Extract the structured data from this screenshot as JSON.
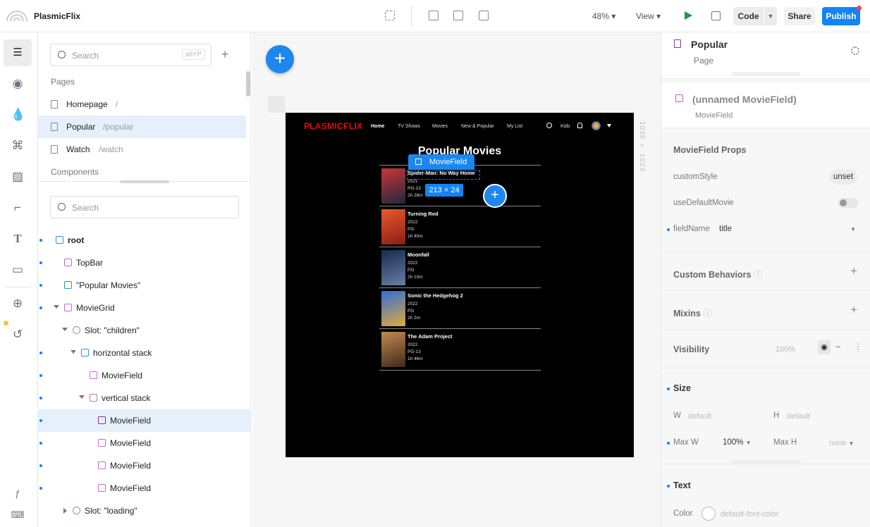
{
  "app": {
    "name": "PlasmicFlix"
  },
  "toolbar": {
    "zoom": "48%",
    "view": "View",
    "code": "Code",
    "share": "Share",
    "publish": "Publish"
  },
  "nav": {
    "search_placeholder": "Search",
    "search_shortcut": "alt+P",
    "pages_label": "Pages",
    "pages": [
      {
        "name": "Homepage",
        "path": "/"
      },
      {
        "name": "Popular",
        "path": "/popular"
      },
      {
        "name": "Watch",
        "path": "/watch"
      }
    ],
    "components_label": "Components",
    "tree_search_placeholder": "Search",
    "tree": [
      {
        "label": "root"
      },
      {
        "label": "TopBar"
      },
      {
        "label": "\"Popular Movies\""
      },
      {
        "label": "MovieGrid"
      },
      {
        "label": "Slot: \"children\""
      },
      {
        "label": "horizontal stack"
      },
      {
        "label": "MovieField"
      },
      {
        "label": "vertical stack"
      },
      {
        "label": "MovieField"
      },
      {
        "label": "MovieField"
      },
      {
        "label": "MovieField"
      },
      {
        "label": "MovieField"
      },
      {
        "label": "Slot: \"loading\""
      }
    ]
  },
  "canvas": {
    "frame_size": "1035 × 1024",
    "selection_tag": "MovieField",
    "selection_size": "213 × 24",
    "site": {
      "logo": "PLASMICFLIX",
      "links": [
        "Home",
        "TV Shows",
        "Movies",
        "New & Popular",
        "My List"
      ],
      "kids": "Kids",
      "title": "Popular Movies",
      "movies": [
        {
          "title": "Spider-Man: No Way Home",
          "year": "2021",
          "rating": "PG-13",
          "runtime": "2h 28m",
          "color": "#7a2a2a"
        },
        {
          "title": "Turning Red",
          "year": "2022",
          "rating": "PG",
          "runtime": "1h 40m",
          "color": "#c43d2a"
        },
        {
          "title": "Moonfall",
          "year": "2022",
          "rating": "PG",
          "runtime": "2h 10m",
          "color": "#1f3c66"
        },
        {
          "title": "Sonic the Hedgehog 2",
          "year": "2022",
          "rating": "PG",
          "runtime": "2h 2m",
          "color": "#2a5fb5"
        },
        {
          "title": "The Adam Project",
          "year": "2022",
          "rating": "PG-13",
          "runtime": "1h 46m",
          "color": "#8a5a34"
        }
      ]
    }
  },
  "right": {
    "page_name": "Popular",
    "page_type": "Page",
    "element_name": "(unnamed MovieField)",
    "element_type": "MovieField",
    "props_title": "MovieField Props",
    "custom_style_label": "customStyle",
    "custom_style_value": "unset",
    "use_default_label": "useDefaultMovie",
    "field_name_label": "fieldName",
    "field_name_value": "title",
    "custom_behaviors": "Custom Behaviors",
    "mixins": "Mixins",
    "visibility": "Visibility",
    "visibility_pct": "100%",
    "size": "Size",
    "w_label": "W",
    "w_value": "default",
    "h_label": "H",
    "h_value": "default",
    "maxw_label": "Max W",
    "maxw_value": "100%",
    "maxh_label": "Max H",
    "maxh_value": "none",
    "text": "Text",
    "color_label": "Color",
    "color_value": "default-font-color"
  },
  "colors": {
    "accent": "#1483f5",
    "publish": "#1483f5",
    "netflix_red": "#e50914",
    "play": "#1a9b3b"
  }
}
